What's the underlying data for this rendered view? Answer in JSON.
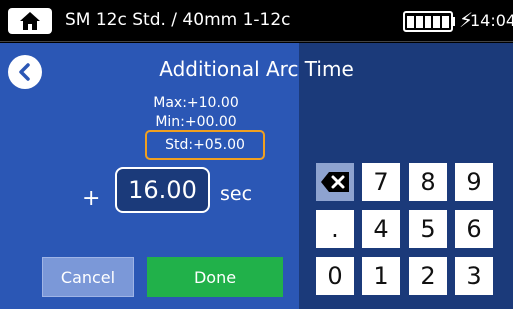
{
  "statusbar": {
    "title": "SM 12c Std. / 40mm 1-12c",
    "time": "14:04",
    "home_icon": "home-icon",
    "battery_icon": "battery-icon",
    "charging_icon": "charging-icon",
    "charge_symbol": "⚡"
  },
  "screen": {
    "title": "Additional Arc Time",
    "back_icon": "back-arrow-icon"
  },
  "range": {
    "max": "Max:+10.00",
    "min": "Min:+00.00",
    "std": "Std:+05.00"
  },
  "entry": {
    "sign": "+",
    "value": "16.00",
    "unit": "sec"
  },
  "buttons": {
    "cancel": "Cancel",
    "done": "Done"
  },
  "keypad": {
    "row1": [
      "⌫",
      "7",
      "8",
      "9"
    ],
    "row2": [
      ".",
      "4",
      "5",
      "6"
    ],
    "row3": [
      "0",
      "1",
      "2",
      "3"
    ]
  },
  "colors": {
    "panel": "#2b57b5",
    "background": "#1b3a7a",
    "std_highlight": "#f0a020",
    "done": "#21b14a",
    "cancel": "#7b98d8"
  }
}
